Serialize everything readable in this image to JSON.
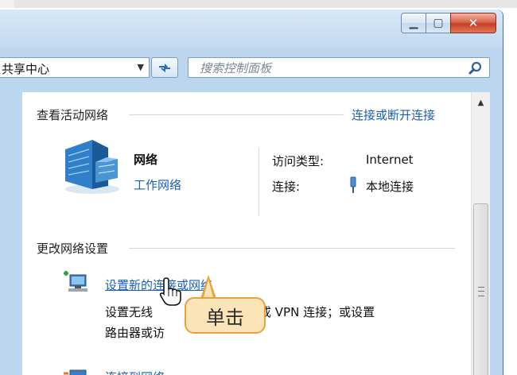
{
  "address": {
    "text": "共享中心"
  },
  "search": {
    "placeholder": "搜索控制面板"
  },
  "active_networks": {
    "title": "查看活动网络",
    "connect_link": "连接或断开连接",
    "network_name": "网络",
    "network_type": "工作网络",
    "access_type_label": "访问类型:",
    "access_type_value": "Internet",
    "connection_label": "连接:",
    "connection_value": "本地连接"
  },
  "change_settings": {
    "title": "更改网络设置",
    "task1_link": "设置新的连接或网络",
    "task1_desc_a": "设置无线",
    "task1_desc_b": "临时或 VPN 连接；或设置",
    "task1_desc_line2": "路由器或访",
    "task2_link": "连接到网络"
  },
  "callout": {
    "text": "单击"
  },
  "colors": {
    "link": "#1a5fb4",
    "callout_fill": "#fbe4b8",
    "callout_border": "#e8a23c",
    "close_button": "#c43e22"
  }
}
